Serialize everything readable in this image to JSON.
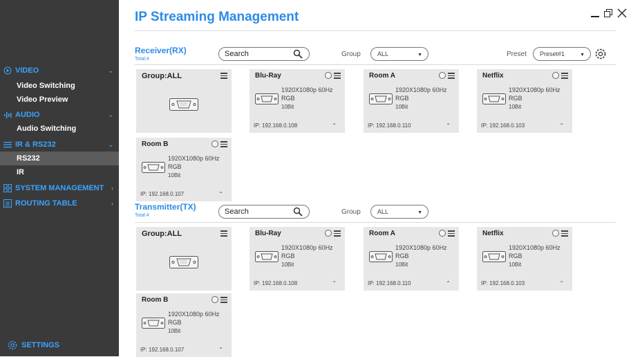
{
  "app": {
    "title": "IP Streaming Management"
  },
  "sidebar": {
    "sections": [
      {
        "label": "VIDEO",
        "items": [
          "Video Switching",
          "Video Preview"
        ]
      },
      {
        "label": "AUDIO",
        "items": [
          "Audio Switching"
        ]
      },
      {
        "label": "IR & RS232",
        "items": [
          "RS232",
          "IR"
        ]
      },
      {
        "label": "SYSTEM MANAGEMENT",
        "items": []
      },
      {
        "label": "ROUTING TABLE",
        "items": []
      }
    ],
    "active_item": "RS232",
    "settings_label": "SETTINGS"
  },
  "receiver": {
    "title": "Receiver(RX)",
    "total": "Total:4",
    "search_placeholder": "Search",
    "group_label": "Group",
    "group_value": "ALL",
    "preset_label": "Preset",
    "preset_value": "Preset#1",
    "group_card": {
      "label": "Group:ALL"
    },
    "cards": [
      {
        "name": "Blu-Ray",
        "resolution": "1920X1080p 60Hz",
        "format": "RGB",
        "depth": "10Bit",
        "ip": "IP: 192.168.0.108"
      },
      {
        "name": "Room A",
        "resolution": "1920X1080p 60Hz",
        "format": "RGB",
        "depth": "10Bit",
        "ip": "IP: 192.168.0.110"
      },
      {
        "name": "Netflix",
        "resolution": "1920X1080p 60Hz",
        "format": "RGB",
        "depth": "10Bit",
        "ip": "IP: 192.168.0.103"
      },
      {
        "name": "Room B",
        "resolution": "1920X1080p 60Hz",
        "format": "RGB",
        "depth": "10Bit",
        "ip": "IP: 192.168.0.107"
      }
    ]
  },
  "transmitter": {
    "title": "Transmitter(TX)",
    "total": "Total:4",
    "search_placeholder": "Search",
    "group_label": "Group",
    "group_value": "ALL",
    "group_card": {
      "label": "Group:ALL"
    },
    "cards": [
      {
        "name": "Blu-Ray",
        "resolution": "1920X1080p 60Hz",
        "format": "RGB",
        "depth": "10Bit",
        "ip": "IP: 192.168.0.108"
      },
      {
        "name": "Room A",
        "resolution": "1920X1080p 60Hz",
        "format": "RGB",
        "depth": "10Bit",
        "ip": "IP: 192.168.0.110"
      },
      {
        "name": "Netflix",
        "resolution": "1920X1080p 60Hz",
        "format": "RGB",
        "depth": "10Bit",
        "ip": "IP: 192.168.0.103"
      },
      {
        "name": "Room B",
        "resolution": "1920X1080p 60Hz",
        "format": "RGB",
        "depth": "10Bit",
        "ip": "IP: 192.168.0.107"
      }
    ]
  },
  "colors": {
    "accent": "#2c8be6",
    "sidebar_bg": "#3a3a3a",
    "sidebar_active": "#5c5c5c",
    "card_bg": "#e7e7e7"
  },
  "icons": [
    "minimize-icon",
    "restore-icon",
    "close-icon",
    "search-icon",
    "gear-icon",
    "hamburger-menu-icon",
    "hdmi-port-icon",
    "chevron-up-icon",
    "chevron-down-icon"
  ]
}
